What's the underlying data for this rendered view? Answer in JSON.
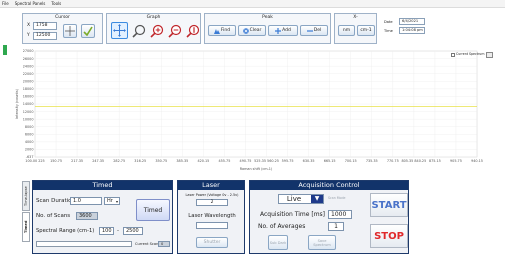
{
  "menu": [
    "File",
    "Spectral Panels",
    "Tools"
  ],
  "toolbar": {
    "cursor": {
      "title": "Cursor",
      "x_label": "X",
      "x_value": "1758",
      "y_label": "Y",
      "y_value": "12500"
    },
    "graph": {
      "title": "Graph"
    },
    "peak": {
      "title": "Peak",
      "find": "Find",
      "clear": "Clear",
      "add": "Add",
      "del": "Del"
    },
    "units": {
      "title": "X-",
      "nm": "nm",
      "cm": "cm-1"
    },
    "date": {
      "label": "Date",
      "value": "6/4/2021"
    },
    "time": {
      "label": "Time",
      "value": "1:04:08 pm"
    },
    "current_spectrum": "Current Spectrum"
  },
  "chart_data": {
    "type": "line",
    "xlabel": "Raman shift (cm-1)",
    "ylabel": "Intensity (counts)",
    "xlim": [
      100,
      2500
    ],
    "ylim": [
      -637,
      27000
    ],
    "x_ticks": [
      "100.00 225",
      "150.75",
      "217.35",
      "247.35",
      "282.75",
      "316.25",
      "350.75",
      "385.35",
      "420.15",
      "455.75",
      "490.75",
      "525.35 560.25",
      "595.75",
      "630.35",
      "665.15",
      "700.15",
      "735.35",
      "770.75",
      "805.35 840.25",
      "875.15",
      "905.75",
      "940.15"
    ],
    "y_ticks": [
      "27000",
      "26000",
      "24000",
      "22000",
      "20000",
      "18000",
      "16000",
      "14000",
      "12000",
      "10000",
      "8000",
      "6000",
      "4000",
      "2000",
      "-637"
    ],
    "series": [
      {
        "x": [
          100,
          2500
        ],
        "y": [
          12500,
          12500
        ],
        "color": "#e8e24a"
      }
    ],
    "grid": true
  },
  "side_tabs": {
    "timed": "Timed",
    "timelapse": "Time-lapse"
  },
  "timed": {
    "title": "Timed",
    "scan_duration_label": "Scan Duration",
    "scan_duration_value": "1.0",
    "scan_unit": "Hr",
    "num_scans_label": "No. of Scans",
    "num_scans_value": "3600",
    "spectral_range_label": "Spectral Range (cm-1)",
    "range_min": "100",
    "range_sep": "-",
    "range_max": "2500",
    "timed_button": "Timed",
    "current_scan_label": "Current Scan",
    "current_scan_value": "0",
    "progress": 0
  },
  "laser": {
    "title": "Laser",
    "power_label": "Laser Power (Voltage 0v - 2.5v)",
    "power_value": "2",
    "wavelength_label": "Laser Wavelength",
    "wavelength_value": "",
    "shutter": "Shutter"
  },
  "acquisition": {
    "title": "Acquisition Control",
    "mode": "Live",
    "mode_hint": "Scan Mode",
    "time_label": "Acquisition Time [ms]",
    "time_value": "1000",
    "averages_label": "No. of Averages",
    "averages_value": "1",
    "sub_dark": "Sub Dark",
    "save_spectrum": "Save Spectrum",
    "start": "START",
    "stop": "STOP",
    "start_color": "#4a73c9",
    "stop_color": "#e0292b"
  }
}
